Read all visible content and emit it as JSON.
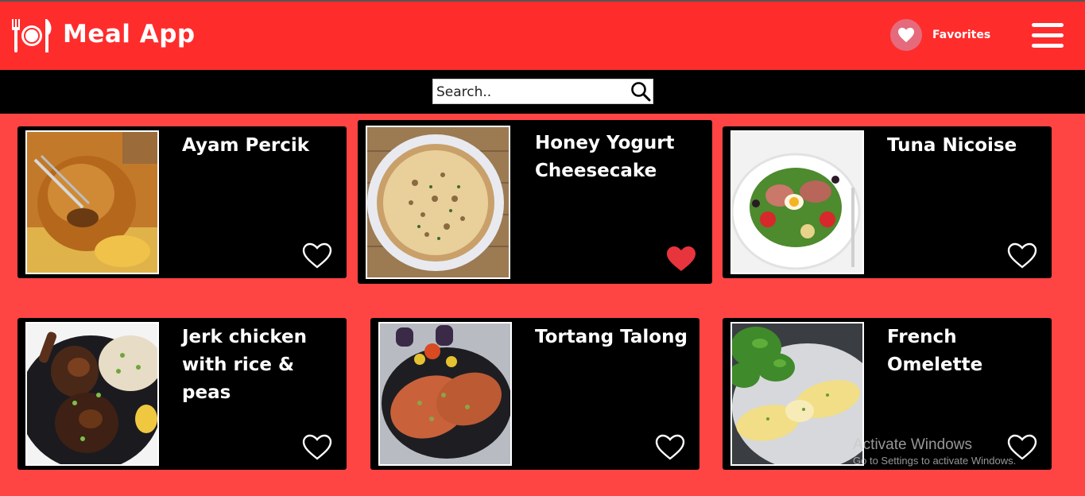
{
  "app": {
    "title": "Meal App",
    "brand_color": "#ff2c2c",
    "background_color": "#ff4444"
  },
  "header": {
    "logo_icon": "plate-cutlery-icon",
    "favorites_label": "Favorites",
    "favorites_icon": "heart-icon",
    "menu_icon": "hamburger-menu-icon"
  },
  "search": {
    "placeholder": "Search..",
    "value": "",
    "icon": "search-icon"
  },
  "meals": [
    {
      "name": "Ayam Percik",
      "favorited": false,
      "image": "grilled-chicken-photo"
    },
    {
      "name": "Honey Yogurt Cheesecake",
      "favorited": true,
      "image": "cheesecake-photo"
    },
    {
      "name": "Tuna Nicoise",
      "favorited": false,
      "image": "tuna-salad-photo"
    },
    {
      "name": "Jerk chicken with rice & peas",
      "favorited": false,
      "image": "jerk-chicken-photo"
    },
    {
      "name": "Tortang Talong",
      "favorited": false,
      "image": "eggplant-omelette-photo"
    },
    {
      "name": "French Omelette",
      "favorited": false,
      "image": "french-omelette-photo"
    }
  ],
  "watermark": {
    "line1": "Activate Windows",
    "line2": "Go to Settings to activate Windows."
  }
}
